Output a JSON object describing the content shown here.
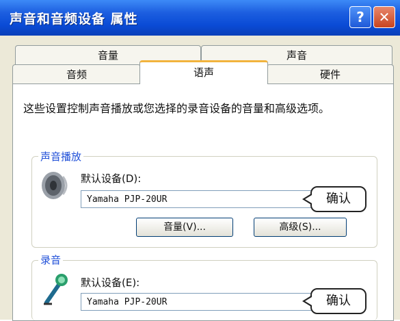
{
  "window": {
    "title": "声音和音频设备 属性",
    "help_symbol": "?",
    "close_symbol": "✕"
  },
  "tabs": {
    "row_back": [
      "音量",
      "声音"
    ],
    "row_front": [
      "音频",
      "语声",
      "硬件"
    ],
    "active": "语声"
  },
  "description": "这些设置控制声音播放或您选择的录音设备的音量和高级选项。",
  "playback": {
    "group_label": "声音播放",
    "device_label": "默认设备(D):",
    "device_value": "Yamaha PJP-20UR",
    "volume_button": "音量(V)...",
    "advanced_button": "高级(S)...",
    "callout": "确认",
    "icon": "speaker-icon"
  },
  "recording": {
    "group_label": "录音",
    "device_label": "默认设备(E):",
    "device_value": "Yamaha PJP-20UR",
    "callout": "确认",
    "icon": "microphone-icon"
  }
}
